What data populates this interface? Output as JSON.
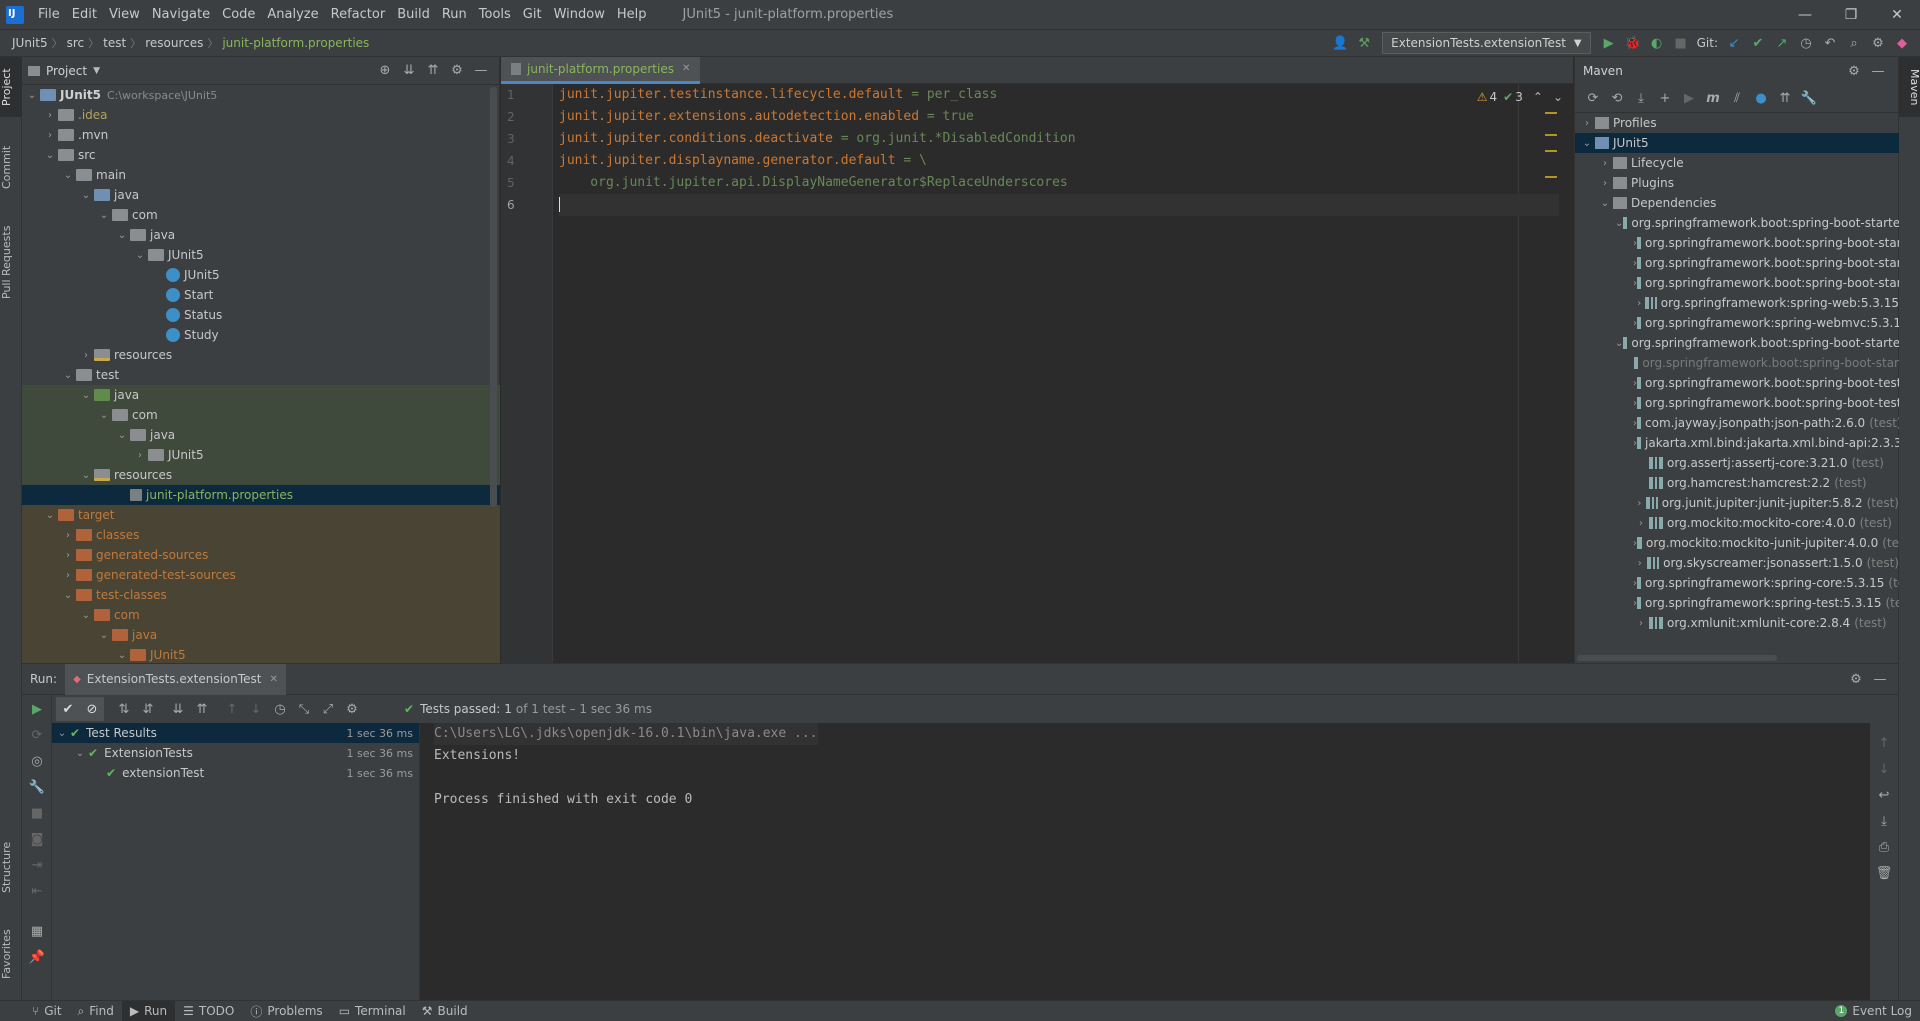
{
  "titlebar": {
    "menus": [
      "File",
      "Edit",
      "View",
      "Navigate",
      "Code",
      "Analyze",
      "Refactor",
      "Build",
      "Run",
      "Tools",
      "Git",
      "Window",
      "Help"
    ],
    "title": "JUnit5 - junit-platform.properties"
  },
  "navbar": {
    "crumbs": [
      "JUnit5",
      "src",
      "test",
      "resources"
    ],
    "file": "junit-platform.properties",
    "run_config": "ExtensionTests.extensionTest",
    "git_label": "Git:"
  },
  "left_strip": {
    "tabs": [
      "Project",
      "Commit",
      "Pull Requests",
      "Structure",
      "Favorites"
    ]
  },
  "right_strip": {
    "tab": "Maven"
  },
  "project": {
    "title": "Project",
    "root_name": "JUnit5",
    "root_path": "C:\\workspace\\JUnit5",
    "nodes": [
      {
        "label": ".idea",
        "depth": 1,
        "arrow": "›",
        "icon": "folder",
        "style": "yellow"
      },
      {
        "label": ".mvn",
        "depth": 1,
        "arrow": "›",
        "icon": "folder",
        "style": ""
      },
      {
        "label": "src",
        "depth": 1,
        "arrow": "⌄",
        "icon": "folder",
        "style": ""
      },
      {
        "label": "main",
        "depth": 2,
        "arrow": "⌄",
        "icon": "folder",
        "style": ""
      },
      {
        "label": "java",
        "depth": 3,
        "arrow": "⌄",
        "icon": "folder-blue",
        "style": ""
      },
      {
        "label": "com",
        "depth": 4,
        "arrow": "⌄",
        "icon": "folder",
        "style": ""
      },
      {
        "label": "java",
        "depth": 5,
        "arrow": "⌄",
        "icon": "folder",
        "style": ""
      },
      {
        "label": "JUnit5",
        "depth": 6,
        "arrow": "⌄",
        "icon": "folder",
        "style": ""
      },
      {
        "label": "JUnit5",
        "depth": 7,
        "arrow": "",
        "icon": "class",
        "style": ""
      },
      {
        "label": "Start",
        "depth": 7,
        "arrow": "",
        "icon": "class",
        "style": ""
      },
      {
        "label": "Status",
        "depth": 7,
        "arrow": "",
        "icon": "enum",
        "style": ""
      },
      {
        "label": "Study",
        "depth": 7,
        "arrow": "",
        "icon": "class",
        "style": ""
      },
      {
        "label": "resources",
        "depth": 3,
        "arrow": "›",
        "icon": "res",
        "style": ""
      },
      {
        "label": "test",
        "depth": 2,
        "arrow": "⌄",
        "icon": "folder",
        "style": ""
      },
      {
        "label": "java",
        "depth": 3,
        "arrow": "⌄",
        "icon": "folder-green",
        "style": "bg-green"
      },
      {
        "label": "com",
        "depth": 4,
        "arrow": "⌄",
        "icon": "folder",
        "style": "bg-green"
      },
      {
        "label": "java",
        "depth": 5,
        "arrow": "⌄",
        "icon": "folder",
        "style": "bg-green"
      },
      {
        "label": "JUnit5",
        "depth": 6,
        "arrow": "›",
        "icon": "folder",
        "style": "bg-green"
      },
      {
        "label": "resources",
        "depth": 3,
        "arrow": "⌄",
        "icon": "res",
        "style": "bg-green"
      },
      {
        "label": "junit-platform.properties",
        "depth": 5,
        "arrow": "",
        "icon": "prop",
        "style": "bg-select green"
      },
      {
        "label": "target",
        "depth": 1,
        "arrow": "⌄",
        "icon": "folder-orange",
        "style": "bg-brown orange"
      },
      {
        "label": "classes",
        "depth": 2,
        "arrow": "›",
        "icon": "folder-orange",
        "style": "bg-brown orange"
      },
      {
        "label": "generated-sources",
        "depth": 2,
        "arrow": "›",
        "icon": "folder-orange",
        "style": "bg-brown orange"
      },
      {
        "label": "generated-test-sources",
        "depth": 2,
        "arrow": "›",
        "icon": "folder-orange",
        "style": "bg-brown orange"
      },
      {
        "label": "test-classes",
        "depth": 2,
        "arrow": "⌄",
        "icon": "folder-orange",
        "style": "bg-brown orange"
      },
      {
        "label": "com",
        "depth": 3,
        "arrow": "⌄",
        "icon": "folder-orange",
        "style": "bg-brown orange"
      },
      {
        "label": "java",
        "depth": 4,
        "arrow": "⌄",
        "icon": "folder-orange",
        "style": "bg-brown orange"
      },
      {
        "label": "JUnit5",
        "depth": 5,
        "arrow": "⌄",
        "icon": "folder-orange",
        "style": "bg-brown orange"
      }
    ]
  },
  "editor": {
    "tab": "junit-platform.properties",
    "warnings": "4",
    "checks": "3",
    "lines": [
      {
        "n": "1",
        "key": "junit.jupiter.testinstance.lifecycle.default",
        "val": " = per_class"
      },
      {
        "n": "2",
        "key": "junit.jupiter.extensions.autodetection.enabled",
        "val": " = true"
      },
      {
        "n": "3",
        "key": "junit.jupiter.conditions.deactivate",
        "val": " = org.junit.*DisabledCondition"
      },
      {
        "n": "4",
        "key": "junit.jupiter.displayname.generator.default",
        "val": " = \\"
      },
      {
        "n": "5",
        "key": "",
        "val": "    org.junit.jupiter.api.DisplayNameGenerator$ReplaceUnderscores"
      },
      {
        "n": "6",
        "key": "",
        "val": ""
      }
    ]
  },
  "maven": {
    "title": "Maven",
    "nodes": [
      {
        "label": "Profiles",
        "depth": 0,
        "arrow": "›",
        "icon": "folder",
        "scope": "",
        "style": ""
      },
      {
        "label": "JUnit5",
        "depth": 0,
        "arrow": "⌄",
        "icon": "proj",
        "scope": "",
        "style": "sel"
      },
      {
        "label": "Lifecycle",
        "depth": 1,
        "arrow": "›",
        "icon": "folder",
        "scope": "",
        "style": ""
      },
      {
        "label": "Plugins",
        "depth": 1,
        "arrow": "›",
        "icon": "folder",
        "scope": "",
        "style": ""
      },
      {
        "label": "Dependencies",
        "depth": 1,
        "arrow": "⌄",
        "icon": "folder",
        "scope": "",
        "style": ""
      },
      {
        "label": "org.springframework.boot:spring-boot-starter-",
        "depth": 2,
        "arrow": "⌄",
        "icon": "lib",
        "scope": "",
        "style": ""
      },
      {
        "label": "org.springframework.boot:spring-boot-star",
        "depth": 3,
        "arrow": "›",
        "icon": "lib",
        "scope": "",
        "style": ""
      },
      {
        "label": "org.springframework.boot:spring-boot-star",
        "depth": 3,
        "arrow": "›",
        "icon": "lib",
        "scope": "",
        "style": ""
      },
      {
        "label": "org.springframework.boot:spring-boot-star",
        "depth": 3,
        "arrow": "›",
        "icon": "lib",
        "scope": "",
        "style": ""
      },
      {
        "label": "org.springframework:spring-web:5.3.15",
        "depth": 3,
        "arrow": "›",
        "icon": "lib",
        "scope": "",
        "style": ""
      },
      {
        "label": "org.springframework:spring-webmvc:5.3.1",
        "depth": 3,
        "arrow": "›",
        "icon": "lib",
        "scope": "",
        "style": ""
      },
      {
        "label": "org.springframework.boot:spring-boot-starter-",
        "depth": 2,
        "arrow": "⌄",
        "icon": "lib",
        "scope": "",
        "style": ""
      },
      {
        "label": "org.springframework.boot:spring-boot-star",
        "depth": 3,
        "arrow": "",
        "icon": "lib",
        "scope": "",
        "style": "gray"
      },
      {
        "label": "org.springframework.boot:spring-boot-test",
        "depth": 3,
        "arrow": "›",
        "icon": "lib",
        "scope": "",
        "style": ""
      },
      {
        "label": "org.springframework.boot:spring-boot-test",
        "depth": 3,
        "arrow": "›",
        "icon": "lib",
        "scope": "",
        "style": ""
      },
      {
        "label": "com.jayway.jsonpath:json-path:2.6.0",
        "depth": 3,
        "arrow": "›",
        "icon": "lib",
        "scope": "(test)",
        "style": ""
      },
      {
        "label": "jakarta.xml.bind:jakarta.xml.bind-api:2.3.3",
        "depth": 3,
        "arrow": "›",
        "icon": "lib",
        "scope": "",
        "style": ""
      },
      {
        "label": "org.assertj:assertj-core:3.21.0",
        "depth": 3,
        "arrow": "",
        "icon": "lib",
        "scope": "(test)",
        "style": ""
      },
      {
        "label": "org.hamcrest:hamcrest:2.2",
        "depth": 3,
        "arrow": "",
        "icon": "lib",
        "scope": "(test)",
        "style": ""
      },
      {
        "label": "org.junit.jupiter:junit-jupiter:5.8.2",
        "depth": 3,
        "arrow": "›",
        "icon": "lib",
        "scope": "(test)",
        "style": ""
      },
      {
        "label": "org.mockito:mockito-core:4.0.0",
        "depth": 3,
        "arrow": "›",
        "icon": "lib",
        "scope": "(test)",
        "style": ""
      },
      {
        "label": "org.mockito:mockito-junit-jupiter:4.0.0",
        "depth": 3,
        "arrow": "›",
        "icon": "lib",
        "scope": "(te",
        "style": ""
      },
      {
        "label": "org.skyscreamer:jsonassert:1.5.0",
        "depth": 3,
        "arrow": "›",
        "icon": "lib",
        "scope": "(test)",
        "style": ""
      },
      {
        "label": "org.springframework:spring-core:5.3.15",
        "depth": 3,
        "arrow": "›",
        "icon": "lib",
        "scope": "(test)",
        "style": ""
      },
      {
        "label": "org.springframework:spring-test:5.3.15",
        "depth": 3,
        "arrow": "›",
        "icon": "lib",
        "scope": "(te",
        "style": ""
      },
      {
        "label": "org.xmlunit:xmlunit-core:2.8.4",
        "depth": 3,
        "arrow": "›",
        "icon": "lib",
        "scope": "(test)",
        "style": ""
      }
    ]
  },
  "run": {
    "label": "Run:",
    "tab": "ExtensionTests.extensionTest",
    "status_prefix": "Tests passed:",
    "status_count": "1",
    "status_suffix": "of 1 test – 1 sec 36 ms",
    "tests": [
      {
        "label": "Test Results",
        "duration": "1 sec 36 ms",
        "depth": 0,
        "arrow": "⌄",
        "sel": true
      },
      {
        "label": "ExtensionTests",
        "duration": "1 sec 36 ms",
        "depth": 1,
        "arrow": "⌄",
        "sel": false
      },
      {
        "label": "extensionTest",
        "duration": "1 sec 36 ms",
        "depth": 2,
        "arrow": "",
        "sel": false
      }
    ],
    "console": [
      "C:\\Users\\LG\\.jdks\\openjdk-16.0.1\\bin\\java.exe ...",
      "Extensions!",
      "",
      "Process finished with exit code 0"
    ]
  },
  "statusbar": {
    "items": [
      "Git",
      "Find",
      "Run",
      "TODO",
      "Problems",
      "Terminal",
      "Build"
    ],
    "icons": [
      "⑂",
      "⌕",
      "▶",
      "☰",
      "ⓘ",
      "▭",
      "⚒"
    ],
    "event_log": "Event Log",
    "event_log_count": "1"
  }
}
